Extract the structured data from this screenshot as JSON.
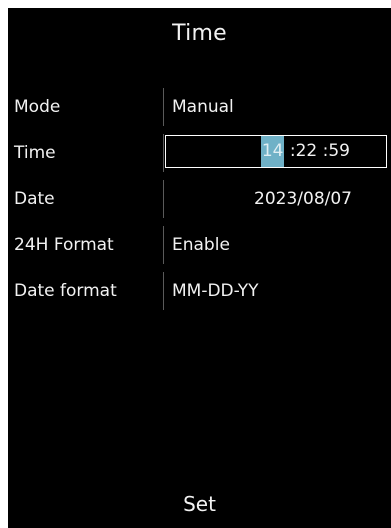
{
  "screen": {
    "title": "Time",
    "set_label": "Set"
  },
  "settings": {
    "mode": {
      "label": "Mode",
      "value": "Manual"
    },
    "time": {
      "label": "Time",
      "hour": "14",
      "minute": ":22",
      "second": ":59",
      "selected_segment": "hour"
    },
    "date": {
      "label": "Date",
      "value": "2023/08/07"
    },
    "format_24h": {
      "label": "24H Format",
      "value": "Enable"
    },
    "date_format": {
      "label": "Date format",
      "value": "MM-DD-YY"
    }
  },
  "colors": {
    "background": "#000000",
    "text": "#f2f2f2",
    "selection_highlight": "#6fb1c7",
    "focus_border": "#ffffff"
  }
}
